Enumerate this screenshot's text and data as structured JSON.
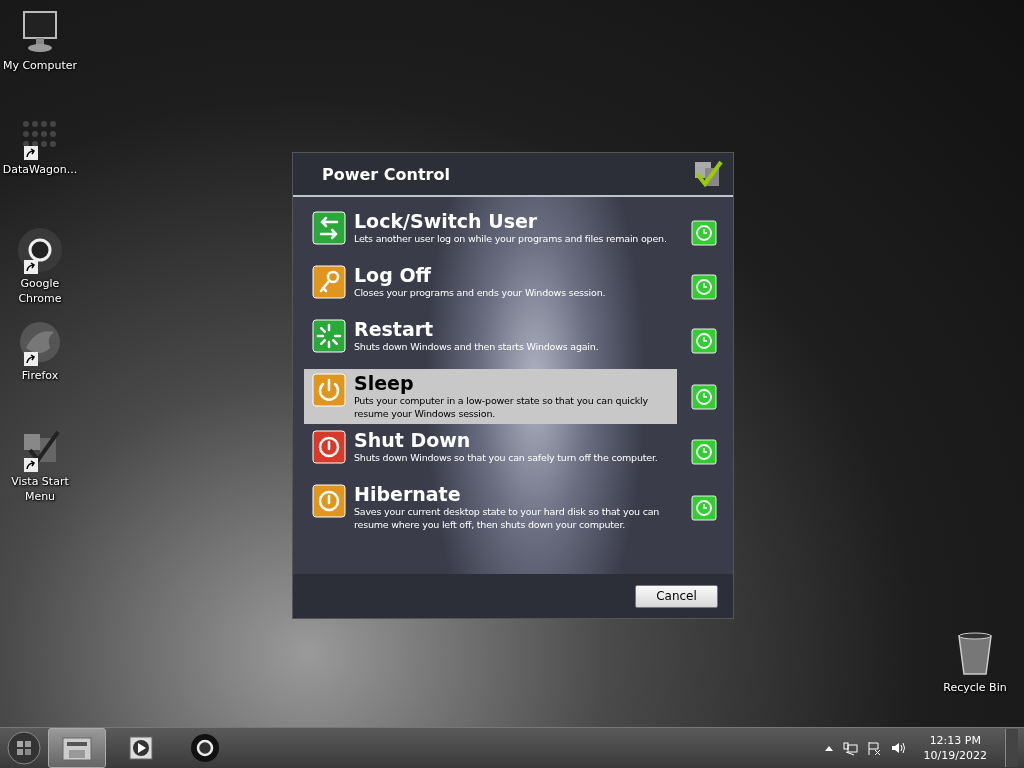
{
  "desktop_icons": [
    {
      "label": "My Computer",
      "kind": "computer",
      "shortcut": false
    },
    {
      "label": "DataWagon...",
      "kind": "dots",
      "shortcut": true
    },
    {
      "label": "Google Chrome",
      "kind": "chrome",
      "shortcut": true
    },
    {
      "label": "Firefox",
      "kind": "firefox",
      "shortcut": true
    },
    {
      "label": "Vista Start Menu",
      "kind": "boxes",
      "shortcut": true
    },
    {
      "label": "Recycle Bin",
      "kind": "bin",
      "shortcut": false
    }
  ],
  "dialog": {
    "title": "Power Control",
    "options": [
      {
        "title": "Lock/Switch User",
        "description": "Lets another user log on while your programs and files remain open.",
        "kind": "lock",
        "color": "#2aa83a",
        "selected": false
      },
      {
        "title": "Log Off",
        "description": "Closes your programs and ends your Windows session.",
        "kind": "key",
        "color": "#e0961e",
        "selected": false
      },
      {
        "title": "Restart",
        "description": "Shuts down Windows and then starts Windows again.",
        "kind": "restart",
        "color": "#2aa83a",
        "selected": false
      },
      {
        "title": "Sleep",
        "description": "Puts your computer in a low-power state so that you can quickly resume your Windows session.",
        "kind": "power",
        "color": "#e0961e",
        "selected": true
      },
      {
        "title": "Shut Down",
        "description": "Shuts down Windows so that you can safely turn off the computer.",
        "kind": "stop",
        "color": "#d83a2a",
        "selected": false
      },
      {
        "title": "Hibernate",
        "description": "Saves your current desktop state to your hard disk so that you can resume where you left off, then shuts down your computer.",
        "kind": "stop",
        "color": "#e0961e",
        "selected": false
      }
    ],
    "cancel_button": "Cancel"
  },
  "taskbar": {
    "items": [
      {
        "kind": "explorer",
        "active": true
      },
      {
        "kind": "media",
        "active": false
      },
      {
        "kind": "chrome",
        "active": false
      }
    ],
    "time": "12:13 PM",
    "date": "10/19/2022"
  }
}
